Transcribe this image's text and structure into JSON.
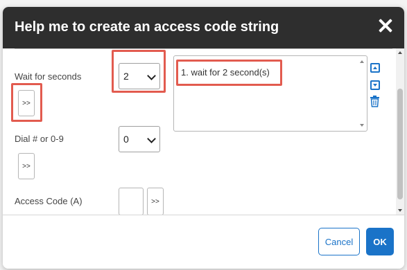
{
  "dialog": {
    "title": "Help me to create an access code string",
    "close_icon": "close-icon"
  },
  "form": {
    "wait": {
      "label": "Wait for seconds",
      "value": "2",
      "add_label": ">>"
    },
    "dial": {
      "label": "Dial # or 0-9",
      "value": "0",
      "add_label": ">>"
    },
    "access_code": {
      "label": "Access Code (A)",
      "value": "",
      "add_label": ">>"
    }
  },
  "sequence": {
    "items": [
      "1. wait for 2 second(s)"
    ],
    "controls": [
      "move-up-icon",
      "move-down-icon",
      "trash-icon"
    ]
  },
  "footer": {
    "cancel_label": "Cancel",
    "ok_label": "OK"
  },
  "colors": {
    "header": "#2e2e2e",
    "accent": "#1a73c8",
    "highlight": "#e25b4f"
  }
}
